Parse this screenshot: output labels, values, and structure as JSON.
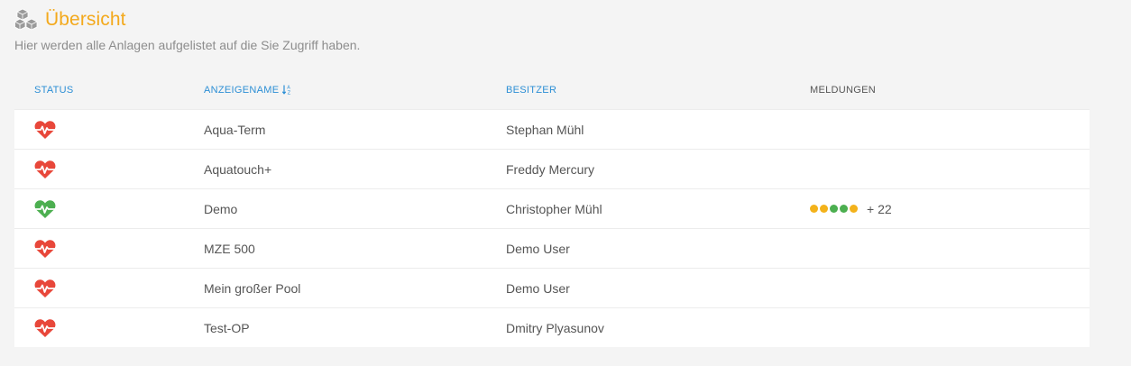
{
  "header": {
    "title": "Übersicht",
    "subtitle": "Hier werden alle Anlagen aufgelistet auf die Sie Zugriff haben.",
    "title_color": "#f3a91c",
    "icon": "cubes-icon"
  },
  "table": {
    "columns": {
      "status": "STATUS",
      "name": "ANZEIGENAME",
      "owner": "BESITZER",
      "messages": "MELDUNGEN"
    },
    "sort_icon": "sort-alpha-asc-icon",
    "rows": [
      {
        "status": "error",
        "status_icon": "heartbeat-icon",
        "status_color": "#e8473a",
        "name": "Aqua-Term",
        "owner": "Stephan Mühl",
        "messages": null
      },
      {
        "status": "error",
        "status_icon": "heartbeat-icon",
        "status_color": "#e8473a",
        "name": "Aquatouch+",
        "owner": "Freddy Mercury",
        "messages": null
      },
      {
        "status": "ok",
        "status_icon": "heartbeat-icon",
        "status_color": "#4caf50",
        "name": "Demo",
        "owner": "Christopher Mühl",
        "messages": {
          "dots": [
            "#f3b21b",
            "#f3b21b",
            "#4caf50",
            "#4caf50",
            "#f3b21b"
          ],
          "more": "+ 22"
        }
      },
      {
        "status": "error",
        "status_icon": "heartbeat-icon",
        "status_color": "#e8473a",
        "name": "MZE 500",
        "owner": "Demo User",
        "messages": null
      },
      {
        "status": "error",
        "status_icon": "heartbeat-icon",
        "status_color": "#e8473a",
        "name": "Mein großer Pool",
        "owner": "Demo User",
        "messages": null
      },
      {
        "status": "error",
        "status_icon": "heartbeat-icon",
        "status_color": "#e8473a",
        "name": "Test-OP",
        "owner": "Dmitry Plyasunov",
        "messages": null
      }
    ]
  }
}
